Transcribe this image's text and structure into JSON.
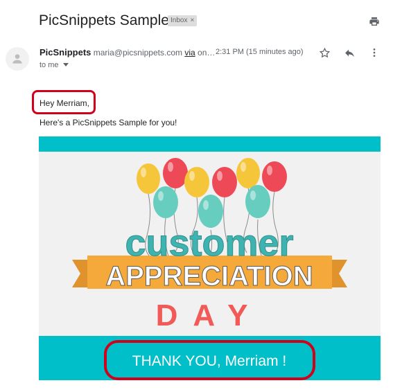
{
  "email": {
    "subject": "PicSnippets Sample",
    "label": "Inbox",
    "sender_name": "PicSnippets",
    "sender_email": "maria@picsnippets.com",
    "via": "via",
    "via_target": "on…",
    "time": "2:31 PM (15 minutes ago)",
    "to": "to me",
    "greeting": "Hey Merriam,",
    "line2": "Here's a PicSnippets Sample for you!"
  },
  "banner": {
    "word1": "customer",
    "word2": "APPRECIATION",
    "word3": "DAY",
    "thanks": "THANK YOU,  Merriam !"
  },
  "icons": {
    "print": "print-icon",
    "star": "star-icon",
    "reply": "reply-icon",
    "more": "more-vert-icon",
    "avatar": "person-icon",
    "caret": "caret-down-icon",
    "chip_close": "close-icon"
  },
  "colors": {
    "teal": "#00bfc8",
    "banner_bg": "#f1f1f1",
    "ribbon": "#f4a93a",
    "day_red": "#f25a57",
    "balloon_yellow": "#f6c63a",
    "balloon_red": "#ee4957",
    "balloon_teal": "#67cdbf",
    "highlight": "#d0021b"
  }
}
